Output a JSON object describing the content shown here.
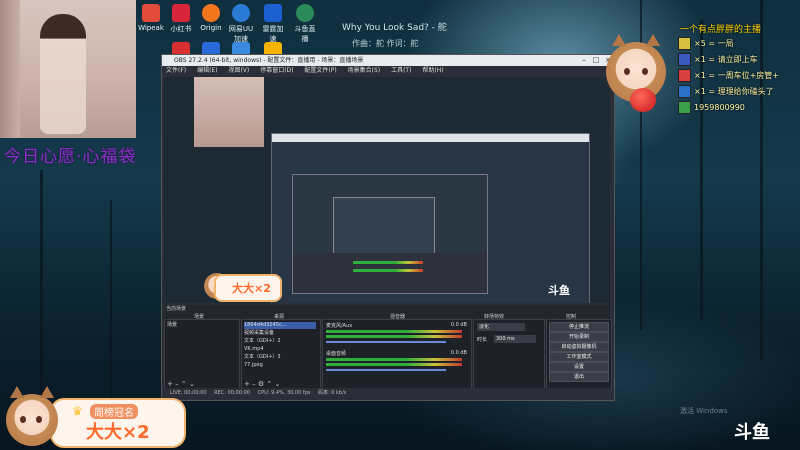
{
  "desktop": {
    "icons": [
      {
        "label": "Wipeak",
        "color": "#e24a3a"
      },
      {
        "label": "小红书",
        "color": "#d8253a"
      },
      {
        "label": "Origin",
        "color": "#f2761c"
      },
      {
        "label": "网易UU加速",
        "color": "#2b7bd6"
      },
      {
        "label": "雷霆加速",
        "color": "#1b5fd1"
      },
      {
        "label": "斗鱼直播",
        "color": "#2a8a5a"
      }
    ],
    "second_row": [
      {
        "label": "",
        "color": "#d83030"
      },
      {
        "label": "",
        "color": "#2a6ad8"
      },
      {
        "label": "",
        "color": "#3a8ae0"
      },
      {
        "label": "",
        "color": "#f4b400"
      }
    ]
  },
  "music": {
    "title": "Why You Look Sad? - 舵",
    "credit": "作曲：舵 作词：舵"
  },
  "overlay_text": "今日心愿·心福袋",
  "obs": {
    "title": "OBS 27.2.4 (64-bit, windows) - 配置文件：直播用 - 场景：直播场景",
    "menu": [
      "文件(F)",
      "编辑(E)",
      "视图(V)",
      "停靠窗口(D)",
      "配置文件(P)",
      "场景集合(S)",
      "工具(T)",
      "帮助(H)"
    ],
    "dock_titles": {
      "scenes": "场景",
      "sources": "来源",
      "mixer": "混音器",
      "transitions": "转场特效",
      "controls": "控制"
    },
    "scene_label": "当前场景",
    "scenes": [
      "场景"
    ],
    "sources": [
      "1864d4d3245c...",
      "视频采集设备",
      "文本（GDI+）2",
      "VK.mp4",
      "文本（GDI+）3",
      "77.jpeg"
    ],
    "mixer": [
      {
        "name": "麦克风/Aux",
        "db": "0.0 dB"
      },
      {
        "name": "桌面音频",
        "db": "0.0 dB"
      }
    ],
    "transition": {
      "type": "淡化",
      "duration_label": "时长",
      "duration": "300 ms"
    },
    "controls": [
      "停止推流",
      "开始录制",
      "启动虚拟摄像机",
      "工作室模式",
      "设置",
      "退出"
    ],
    "status": [
      "LIVE: 00:00:00",
      "REC: 00:00:00",
      "CPU: 9.4%, 30.00 fps",
      "码率: 0 kb/s"
    ]
  },
  "chat": {
    "header": "一个有点胖胖的主播",
    "rows": [
      {
        "text": "×5 = 一局"
      },
      {
        "text": "×1 = 请立即上车"
      },
      {
        "text": "×1 = 一周车位+房管+"
      },
      {
        "text": "×1 = 理理给你磕头了"
      },
      {
        "text": "1959800990"
      }
    ]
  },
  "badges": {
    "top": "周榜冠名",
    "big": "大大×2"
  },
  "watermark": {
    "douyu": "斗鱼",
    "windows": "激活 Windows"
  }
}
